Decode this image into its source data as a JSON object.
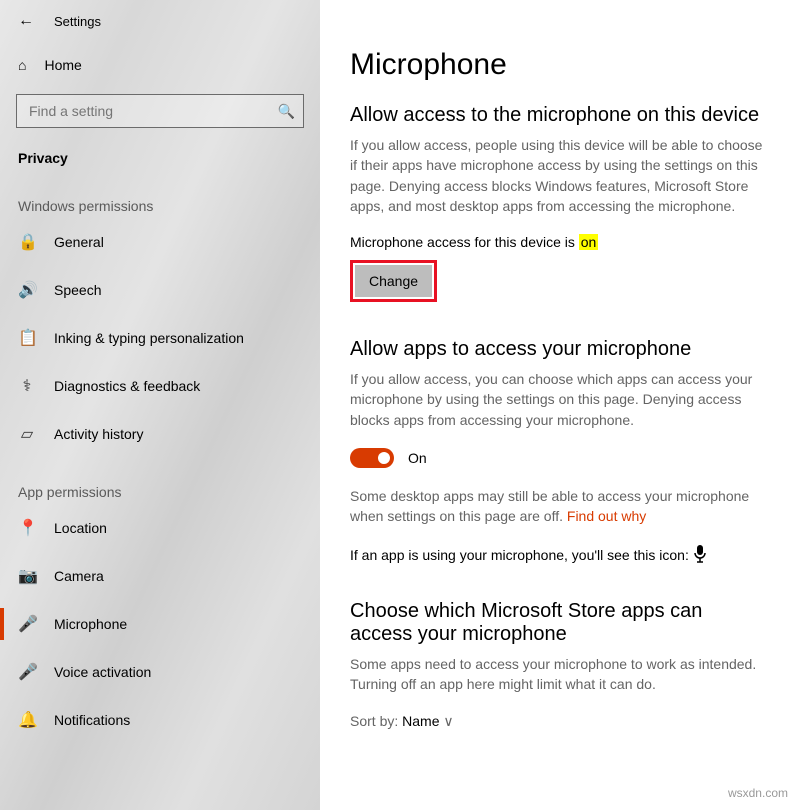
{
  "app": {
    "title": "Settings"
  },
  "sidebar": {
    "home": "Home",
    "search_placeholder": "Find a setting",
    "category": "Privacy",
    "windows_perm_label": "Windows permissions",
    "app_perm_label": "App permissions",
    "windows_perms": [
      {
        "icon": "lock-icon",
        "label": "General"
      },
      {
        "icon": "speech-icon",
        "label": "Speech"
      },
      {
        "icon": "inking-icon",
        "label": "Inking & typing personalization"
      },
      {
        "icon": "diagnostics-icon",
        "label": "Diagnostics & feedback"
      },
      {
        "icon": "activity-icon",
        "label": "Activity history"
      }
    ],
    "app_perms": [
      {
        "icon": "location-icon",
        "label": "Location"
      },
      {
        "icon": "camera-icon",
        "label": "Camera"
      },
      {
        "icon": "mic-icon",
        "label": "Microphone",
        "active": true
      },
      {
        "icon": "voice-icon",
        "label": "Voice activation"
      },
      {
        "icon": "notifications-icon",
        "label": "Notifications"
      }
    ]
  },
  "main": {
    "title": "Microphone",
    "sec1": {
      "heading": "Allow access to the microphone on this device",
      "text": "If you allow access, people using this device will be able to choose if their apps have microphone access by using the settings on this page. Denying access blocks Windows features, Microsoft Store apps, and most desktop apps from accessing the microphone.",
      "status_prefix": "Microphone access for this device is ",
      "status_value": "on",
      "change": "Change"
    },
    "sec2": {
      "heading": "Allow apps to access your microphone",
      "text": "If you allow access, you can choose which apps can access your microphone by using the settings on this page. Denying access blocks apps from accessing your microphone.",
      "toggle_label": "On",
      "desktop_note": "Some desktop apps may still be able to access your microphone when settings on this page are off. ",
      "find_out": "Find out why",
      "icon_line": "If an app is using your microphone, you'll see this icon:"
    },
    "sec3": {
      "heading": "Choose which Microsoft Store apps can access your microphone",
      "text": "Some apps need to access your microphone to work as intended. Turning off an app here might limit what it can do.",
      "sort_prefix": "Sort by: ",
      "sort_value": "Name"
    }
  },
  "watermark": "wsxdn.com"
}
